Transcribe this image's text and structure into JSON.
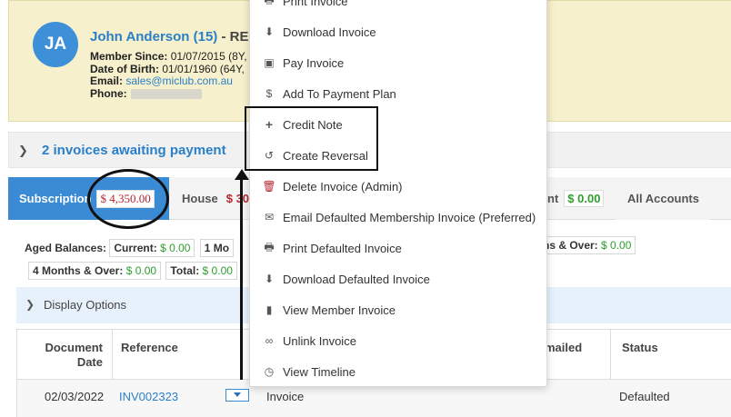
{
  "member": {
    "initials": "JA",
    "name": "John Anderson (15)",
    "name_suffix": " - RE",
    "member_since_label": "Member Since:",
    "member_since_value": " 01/07/2015 (8Y,",
    "dob_label": "Date of Birth:",
    "dob_value": " 01/01/1960 (64Y,",
    "email_label": "Email:",
    "email_value": "sales@miclub.com.au",
    "phone_label": "Phone:"
  },
  "awaiting": {
    "text": "2 invoices awaiting payment"
  },
  "tabs": [
    {
      "label": "Subscription",
      "amount": "$ 4,350.00"
    },
    {
      "label": "House",
      "amount": "$ 30"
    },
    {
      "label": "nt",
      "amount": "$ 0.00"
    },
    {
      "label": "All Accounts"
    }
  ],
  "aged": {
    "label": "Aged Balances:",
    "current_label": "Current:",
    "current_value": "$ 0.00",
    "one_month_label": "1 Mo",
    "months_over_partial": "ths & Over:",
    "months_over_partial_value": "$ 0.00",
    "four_months_label": "4 Months & Over:",
    "four_months_value": "$ 0.00",
    "total_label": "Total:",
    "total_value": "$ 0.00"
  },
  "display_options": {
    "label": "Display Options"
  },
  "table": {
    "headers": {
      "doc_date": "Document Date",
      "reference": "Reference",
      "emailed": "mailed",
      "status": "Status"
    },
    "row": {
      "date": "02/03/2022",
      "reference": "INV002323",
      "type": "Invoice",
      "status": "Defaulted"
    }
  },
  "menu": {
    "items": [
      {
        "label": "Print Invoice",
        "icon": "print-icon"
      },
      {
        "label": "Download Invoice",
        "icon": "download-icon"
      },
      {
        "label": "Pay Invoice",
        "icon": "money-icon"
      },
      {
        "label": "Add To Payment Plan",
        "icon": "dollar-icon"
      },
      {
        "label": "Credit Note",
        "icon": "plus-icon"
      },
      {
        "label": "Create Reversal",
        "icon": "undo-icon"
      },
      {
        "label": "Delete Invoice (Admin)",
        "icon": "trash-icon"
      },
      {
        "label": "Email Defaulted Membership Invoice (Preferred)",
        "icon": "envelope-icon"
      },
      {
        "label": "Print Defaulted Invoice",
        "icon": "print-icon"
      },
      {
        "label": "Download Defaulted Invoice",
        "icon": "download-icon"
      },
      {
        "label": "View Member Invoice",
        "icon": "file-icon"
      },
      {
        "label": "Unlink Invoice",
        "icon": "unlink-icon"
      },
      {
        "label": "View Timeline",
        "icon": "clock-icon"
      }
    ]
  },
  "colors": {
    "accent": "#3a8ad4",
    "link": "#2a7fc9",
    "header_bg": "#f6f0cc",
    "negative": "#b5262e",
    "positive": "#2e9e2e"
  }
}
